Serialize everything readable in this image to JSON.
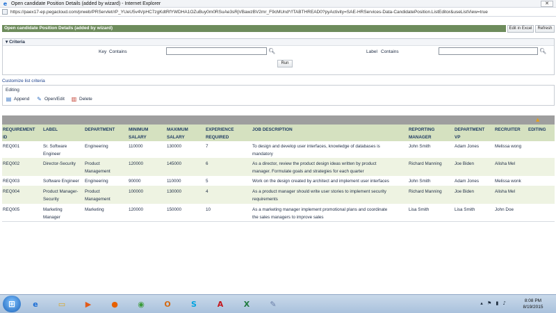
{
  "window": {
    "title": "Open candidate Position Details (added by wizard) - Internet Explorer",
    "url": "https://paex17-ep.pegacloud.com/prweb/PRServlet/rP_YUeU5v4VpHC7zgKdtRfYWDHA1OZuBuy0m0RSuAe3sRjVBawzBV2mr_F9cMUnd*/!TABTHREAD0?pyActivity=SAE-HRServices-Data-CandidatePosition.ListEditor&useListView=true"
  },
  "header": {
    "title": "Open candidate Position Details (added by wizard)",
    "edit_excel": "Edit in Excel",
    "refresh": "Refresh"
  },
  "criteria": {
    "title": "Criteria",
    "key_label": "Key",
    "key_op": "Contains",
    "label_label": "Label",
    "label_op": "Contains",
    "run": "Run"
  },
  "customize_link": "Customize list criteria",
  "editing": {
    "title": "Editing",
    "append": "Append",
    "open_edit": "Open/Edit",
    "delete": "Delete"
  },
  "columns": {
    "req_1": "REQUIREMENT",
    "req_2": "ID",
    "label": "LABEL",
    "department": "DEPARTMENT",
    "min_1": "MINIMUM",
    "min_2": "SALARY",
    "max_1": "MAXIMUM",
    "max_2": "SALARY",
    "exp_1": "EXPERIENCE",
    "exp_2": "REQUIRED",
    "job": "JOB DESCRIPTION",
    "rm_1": "REPORTING",
    "rm_2": "MANAGER",
    "dvp_1": "DEPARTMENT",
    "dvp_2": "VP",
    "recruiter": "RECRUITER",
    "editing": "EDITING"
  },
  "rows": [
    {
      "id": "REQ001",
      "label_1": "Sr. Software",
      "label_2": "Engineer",
      "dept_1": "Engineering",
      "dept_2": "",
      "min": "110000",
      "max": "130000",
      "exp": "7",
      "job_1": "To design and develop user interfaces, knowledge of databases is",
      "job_2": "mandatory",
      "rm": "John Smith",
      "dvp": "Adam Jones",
      "recruiter": "Melissa wong"
    },
    {
      "id": "REQ002",
      "label_1": "Director-Security",
      "label_2": "",
      "dept_1": "Product",
      "dept_2": "Management",
      "min": "120000",
      "max": "145000",
      "exp": "6",
      "job_1": "As a director, review the product design ideas written by product",
      "job_2": "manager. Formulate goals and strategies for each quarter",
      "rm": "Richard Manning",
      "dvp": "Joe Biden",
      "recruiter": "Alisha Mel"
    },
    {
      "id": "REQ003",
      "label_1": "Software Engineer",
      "label_2": "",
      "dept_1": "Engineering",
      "dept_2": "",
      "min": "90000",
      "max": "110000",
      "exp": "5",
      "job_1": "Work on the design created by architect and implement user interfaces",
      "job_2": "",
      "rm": "John Smith",
      "dvp": "Adam Jones",
      "recruiter": "Melissa wonk"
    },
    {
      "id": "REQ004",
      "label_1": "Product Manager-",
      "label_2": "Security",
      "dept_1": "Product",
      "dept_2": "Management",
      "min": "100000",
      "max": "130000",
      "exp": "4",
      "job_1": "As a product manager should write user stories to implement security",
      "job_2": "requirements",
      "rm": "Richard Manning",
      "dvp": "Joe Biden",
      "recruiter": "Alisha Mel"
    },
    {
      "id": "REQ005",
      "label_1": "Marketing",
      "label_2": "Manager",
      "dept_1": "Marketing",
      "dept_2": "",
      "min": "120000",
      "max": "150000",
      "exp": "10",
      "job_1": "As a marketing manager implement promotional plans and coordinate",
      "job_2": "the sales managers to improve sales",
      "rm": "Lisa Smith",
      "dvp": "Lisa Smith",
      "recruiter": "John Doe"
    }
  ],
  "taskbar": {
    "time": "8:08 PM",
    "date": "8/19/2015"
  },
  "icons": {
    "browser": "internet-explorer-icon",
    "search": "magnifier-icon",
    "append": "append-icon",
    "open_edit": "edit-icon",
    "delete": "delete-icon",
    "sort": "sort-icon"
  },
  "colors": {
    "header_bar": "#6e8c5c",
    "grid_header": "#d5e1c0",
    "grid_alt_row": "#eef3e2",
    "grid_top_bar": "#9e9e9e",
    "link": "#1a3f8a"
  }
}
